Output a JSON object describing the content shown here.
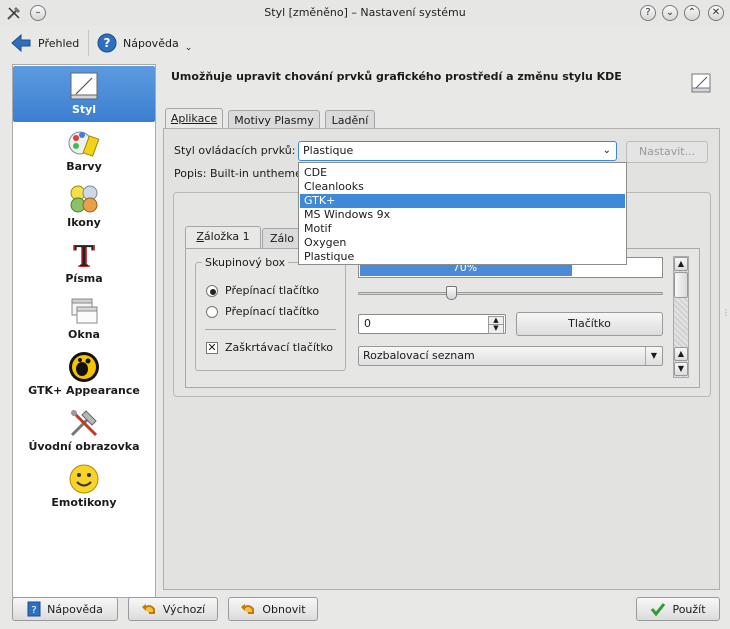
{
  "window": {
    "title": "Styl [změněno] – Nastavení systému"
  },
  "toolbar": {
    "overview_label": "Přehled",
    "help_label": "Nápověda"
  },
  "sidebar": {
    "items": [
      {
        "label": "Styl",
        "icon": "style-icon",
        "selected": true
      },
      {
        "label": "Barvy",
        "icon": "colors-icon"
      },
      {
        "label": "Ikony",
        "icon": "icons-icon"
      },
      {
        "label": "Písma",
        "icon": "fonts-icon"
      },
      {
        "label": "Okna",
        "icon": "windows-icon"
      },
      {
        "label": "GTK+ Appearance",
        "icon": "gtk-icon"
      },
      {
        "label": "Úvodní obrazovka",
        "icon": "splash-icon"
      },
      {
        "label": "Emotikony",
        "icon": "emoticons-icon"
      }
    ]
  },
  "main": {
    "header": "Umožňuje upravit chování prvků grafického prostředí a změnu stylu KDE",
    "tabs": [
      "Aplikace",
      "Motivy Plasmy",
      "Ladění"
    ],
    "style_label": "Styl ovládacích prvků:",
    "style_value": "Plastique",
    "configure_label": "Nastavit...",
    "description": "Popis: Built-in unthemed",
    "dropdown_options": [
      "CDE",
      "Cleanlooks",
      "GTK+",
      "MS Windows 9x",
      "Motif",
      "Oxygen",
      "Plastique"
    ],
    "dropdown_selected": "GTK+"
  },
  "preview": {
    "tab1": "Záložka 1",
    "tab2": "Zálo",
    "groupbox": "Skupinový box",
    "radio1": "Přepínací tlačítko",
    "radio2": "Přepínací tlačítko",
    "checkbox": "Zaškrtávací tlačítko",
    "progress_text": "70%",
    "progress_value": 0.7,
    "slider_value": 0.3,
    "spin_value": "0",
    "button_label": "Tlačítko",
    "combo_value": "Rozbalovací seznam"
  },
  "bottom": {
    "help": "Nápověda",
    "default": "Výchozí",
    "reset": "Obnovit",
    "apply": "Použít"
  },
  "colors": {
    "accent": "#3e8ad6",
    "selection": "#4a8ad8"
  }
}
